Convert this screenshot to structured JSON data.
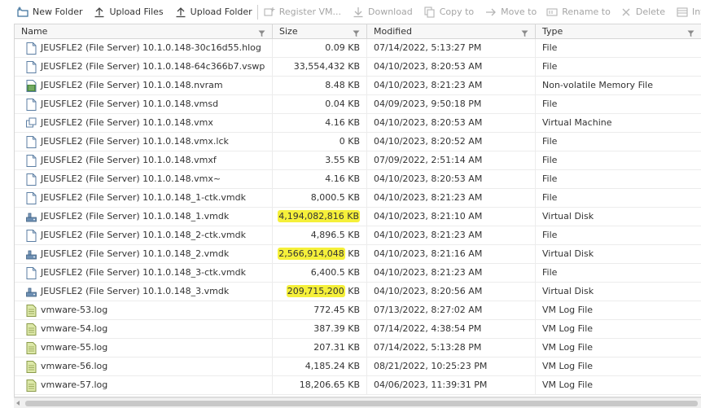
{
  "toolbar": {
    "new_folder": "New Folder",
    "upload_files": "Upload Files",
    "upload_folder": "Upload Folder",
    "register_vm": "Register VM...",
    "download": "Download",
    "copy_to": "Copy to",
    "move_to": "Move to",
    "rename_to": "Rename to",
    "delete": "Delete",
    "inflate": "Inflate"
  },
  "columns": {
    "name": "Name",
    "size": "Size",
    "modified": "Modified",
    "type": "Type"
  },
  "rows": [
    {
      "icon": "file-icon",
      "name": "JEUSFLE2 (File Server) 10.1.0.148-30c16d55.hlog",
      "size_pre": "",
      "size_num": "0.09 KB",
      "size_suf": "",
      "modified": "07/14/2022, 5:13:27 PM",
      "type": "File"
    },
    {
      "icon": "file-icon",
      "name": "JEUSFLE2 (File Server) 10.1.0.148-64c366b7.vswp",
      "size_pre": "",
      "size_num": "33,554,432 KB",
      "size_suf": "",
      "modified": "04/10/2023, 8:20:53 AM",
      "type": "File"
    },
    {
      "icon": "nvram-icon",
      "name": "JEUSFLE2 (File Server) 10.1.0.148.nvram",
      "size_pre": "",
      "size_num": "8.48 KB",
      "size_suf": "",
      "modified": "04/10/2023, 8:21:23 AM",
      "type": "Non-volatile Memory File"
    },
    {
      "icon": "file-icon",
      "name": "JEUSFLE2 (File Server) 10.1.0.148.vmsd",
      "size_pre": "",
      "size_num": "0.04 KB",
      "size_suf": "",
      "modified": "04/09/2023, 9:50:18 PM",
      "type": "File"
    },
    {
      "icon": "virtual-machine-icon",
      "name": "JEUSFLE2 (File Server) 10.1.0.148.vmx",
      "size_pre": "",
      "size_num": "4.16 KB",
      "size_suf": "",
      "modified": "04/10/2023, 8:20:53 AM",
      "type": "Virtual Machine"
    },
    {
      "icon": "file-icon",
      "name": "JEUSFLE2 (File Server) 10.1.0.148.vmx.lck",
      "size_pre": "",
      "size_num": "0 KB",
      "size_suf": "",
      "modified": "04/10/2023, 8:20:52 AM",
      "type": "File"
    },
    {
      "icon": "file-icon",
      "name": "JEUSFLE2 (File Server) 10.1.0.148.vmxf",
      "size_pre": "",
      "size_num": "3.55 KB",
      "size_suf": "",
      "modified": "07/09/2022, 2:51:14 AM",
      "type": "File"
    },
    {
      "icon": "file-icon",
      "name": "JEUSFLE2 (File Server) 10.1.0.148.vmx~",
      "size_pre": "",
      "size_num": "4.16 KB",
      "size_suf": "",
      "modified": "04/10/2023, 8:20:53 AM",
      "type": "File"
    },
    {
      "icon": "file-icon",
      "name": "JEUSFLE2 (File Server) 10.1.0.148_1-ctk.vmdk",
      "size_pre": "",
      "size_num": "8,000.5 KB",
      "size_suf": "",
      "modified": "04/10/2023, 8:21:23 AM",
      "type": "File"
    },
    {
      "icon": "virtual-disk-icon",
      "name": "JEUSFLE2 (File Server) 10.1.0.148_1.vmdk",
      "size_pre": "4,194,082,816 KB",
      "size_num": "",
      "size_suf": "",
      "modified": "04/10/2023, 8:21:10 AM",
      "type": "Virtual Disk"
    },
    {
      "icon": "file-icon",
      "name": "JEUSFLE2 (File Server) 10.1.0.148_2-ctk.vmdk",
      "size_pre": "",
      "size_num": "4,896.5 KB",
      "size_suf": "",
      "modified": "04/10/2023, 8:21:23 AM",
      "type": "File"
    },
    {
      "icon": "virtual-disk-icon",
      "name": "JEUSFLE2 (File Server) 10.1.0.148_2.vmdk",
      "size_pre": "2,566,914,048",
      "size_num": "",
      "size_suf": " KB",
      "modified": "04/10/2023, 8:21:16 AM",
      "type": "Virtual Disk"
    },
    {
      "icon": "file-icon",
      "name": "JEUSFLE2 (File Server) 10.1.0.148_3-ctk.vmdk",
      "size_pre": "",
      "size_num": "6,400.5 KB",
      "size_suf": "",
      "modified": "04/10/2023, 8:21:23 AM",
      "type": "File"
    },
    {
      "icon": "virtual-disk-icon",
      "name": "JEUSFLE2 (File Server) 10.1.0.148_3.vmdk",
      "size_pre": "209,715,200",
      "size_num": "",
      "size_suf": " KB",
      "modified": "04/10/2023, 8:20:56 AM",
      "type": "Virtual Disk"
    },
    {
      "icon": "log-file-icon",
      "name": "vmware-53.log",
      "size_pre": "",
      "size_num": "772.45 KB",
      "size_suf": "",
      "modified": "07/13/2022, 8:27:02 AM",
      "type": "VM Log File"
    },
    {
      "icon": "log-file-icon",
      "name": "vmware-54.log",
      "size_pre": "",
      "size_num": "387.39 KB",
      "size_suf": "",
      "modified": "07/14/2022, 4:38:54 PM",
      "type": "VM Log File"
    },
    {
      "icon": "log-file-icon",
      "name": "vmware-55.log",
      "size_pre": "",
      "size_num": "207.31 KB",
      "size_suf": "",
      "modified": "07/14/2022, 5:13:28 PM",
      "type": "VM Log File"
    },
    {
      "icon": "log-file-icon",
      "name": "vmware-56.log",
      "size_pre": "",
      "size_num": "4,185.24 KB",
      "size_suf": "",
      "modified": "08/21/2022, 10:25:23 PM",
      "type": "VM Log File"
    },
    {
      "icon": "log-file-icon",
      "name": "vmware-57.log",
      "size_pre": "",
      "size_num": "18,206.65 KB",
      "size_suf": "",
      "modified": "04/06/2023, 11:39:31 PM",
      "type": "VM Log File"
    }
  ],
  "colors": {
    "highlight": "#f5f03a",
    "toolbar_icon": "#3a6f9a",
    "disabled": "#a5a5a5",
    "log_icon": "#c8d98a",
    "nvram_icon": "#4a8a3a"
  }
}
